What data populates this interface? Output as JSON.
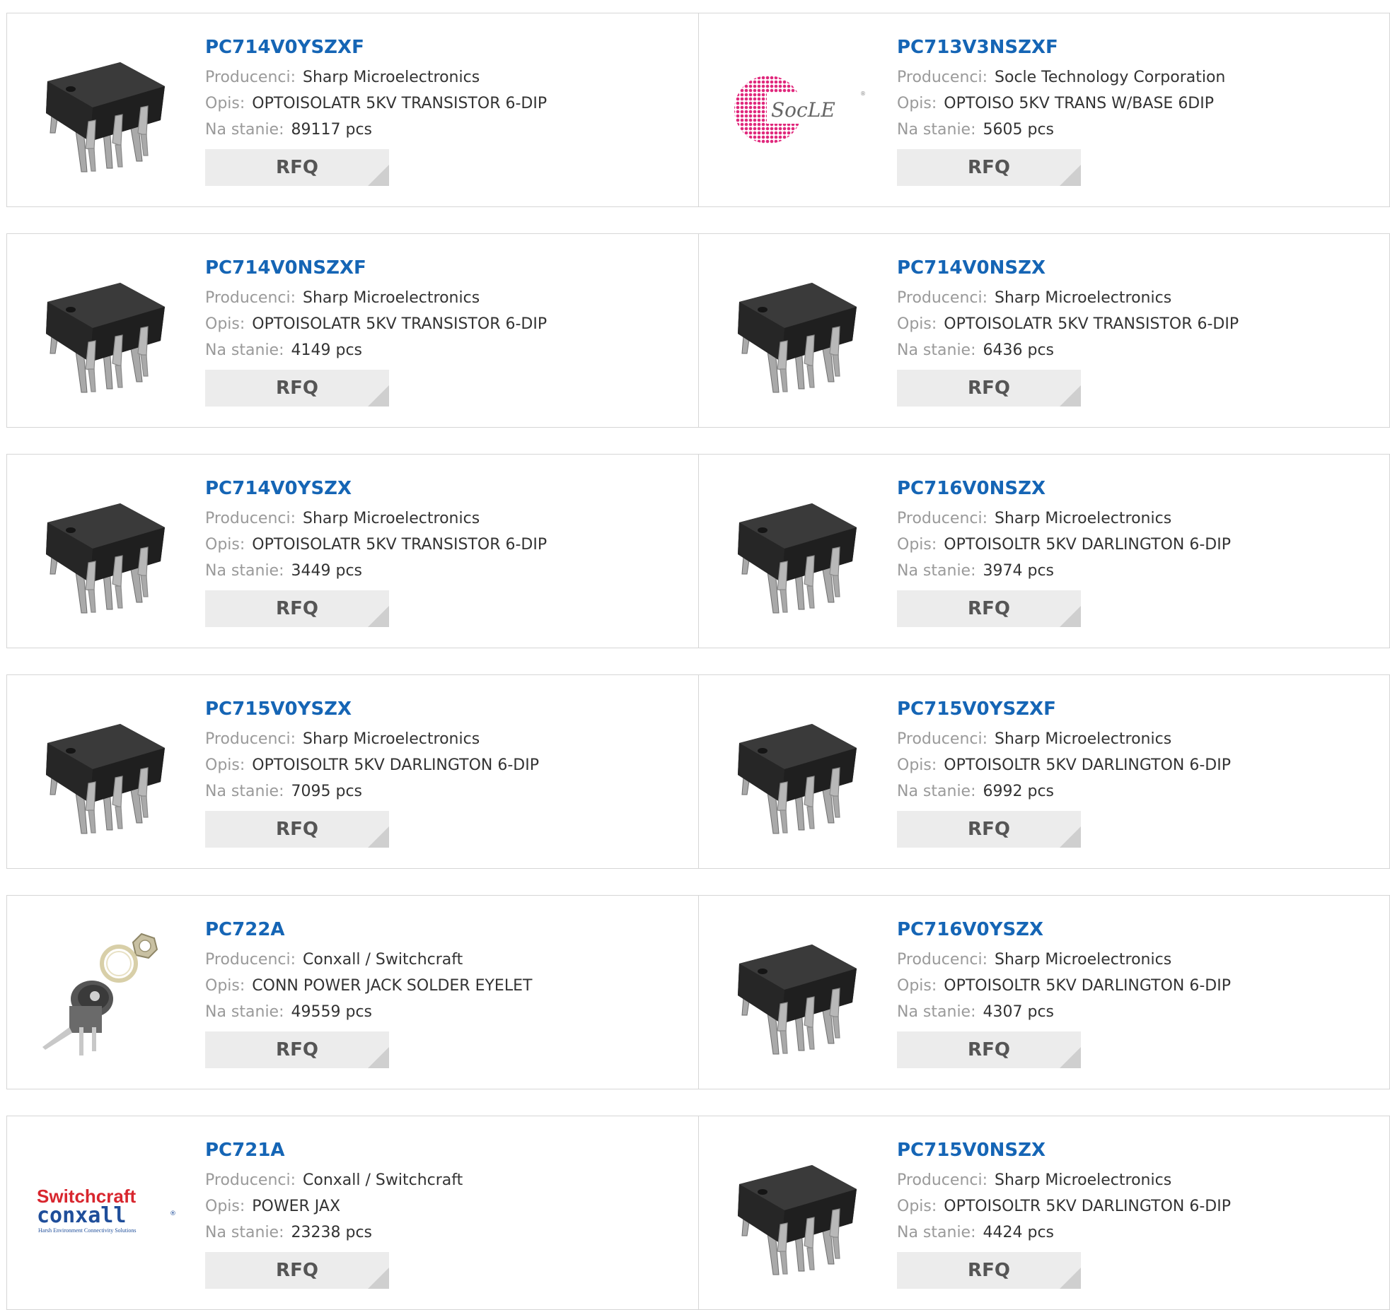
{
  "labels": {
    "manufacturer": "Producenci:",
    "description": "Opis:",
    "stock": "Na stanie:",
    "rfq": "RFQ"
  },
  "products": [
    {
      "part": "PC714V0YSZXF",
      "manufacturer": "Sharp Microelectronics",
      "description": "OPTOISOLATR 5KV TRANSISTOR 6-DIP",
      "stock": "89117 pcs",
      "image": "dip6-chip-icon"
    },
    {
      "part": "PC713V3NSZXF",
      "manufacturer": "Socle Technology Corporation",
      "description": "OPTOISO 5KV TRANS W/BASE 6DIP",
      "stock": "5605 pcs",
      "image": "socle-logo",
      "logo_text": "SocLE"
    },
    {
      "part": "PC714V0NSZXF",
      "manufacturer": "Sharp Microelectronics",
      "description": "OPTOISOLATR 5KV TRANSISTOR 6-DIP",
      "stock": "4149 pcs",
      "image": "dip6-chip-icon"
    },
    {
      "part": "PC714V0NSZX",
      "manufacturer": "Sharp Microelectronics",
      "description": "OPTOISOLATR 5KV TRANSISTOR 6-DIP",
      "stock": "6436 pcs",
      "image": "dip6-chip-icon"
    },
    {
      "part": "PC714V0YSZX",
      "manufacturer": "Sharp Microelectronics",
      "description": "OPTOISOLATR 5KV TRANSISTOR 6-DIP",
      "stock": "3449 pcs",
      "image": "dip6-chip-icon"
    },
    {
      "part": "PC716V0NSZX",
      "manufacturer": "Sharp Microelectronics",
      "description": "OPTOISOLTR 5KV DARLINGTON 6-DIP",
      "stock": "3974 pcs",
      "image": "dip6-chip-icon"
    },
    {
      "part": "PC715V0YSZX",
      "manufacturer": "Sharp Microelectronics",
      "description": "OPTOISOLTR 5KV DARLINGTON 6-DIP",
      "stock": "7095 pcs",
      "image": "dip6-chip-icon"
    },
    {
      "part": "PC715V0YSZXF",
      "manufacturer": "Sharp Microelectronics",
      "description": "OPTOISOLTR 5KV DARLINGTON 6-DIP",
      "stock": "6992 pcs",
      "image": "dip6-chip-icon"
    },
    {
      "part": "PC722A",
      "manufacturer": "Conxall / Switchcraft",
      "description": "CONN POWER JACK SOLDER EYELET",
      "stock": "49559 pcs",
      "image": "power-jack-icon"
    },
    {
      "part": "PC716V0YSZX",
      "manufacturer": "Sharp Microelectronics",
      "description": "OPTOISOLTR 5KV DARLINGTON 6-DIP",
      "stock": "4307 pcs",
      "image": "dip6-chip-icon"
    },
    {
      "part": "PC721A",
      "manufacturer": "Conxall / Switchcraft",
      "description": "POWER JAX",
      "stock": "23238 pcs",
      "image": "switchcraft-conxall-logo",
      "logo_text": [
        "Switchcraft",
        "conxall",
        "Harsh Environment Connectivity Solutions"
      ]
    },
    {
      "part": "PC715V0NSZX",
      "manufacturer": "Sharp Microelectronics",
      "description": "OPTOISOLTR 5KV DARLINGTON 6-DIP",
      "stock": "4424 pcs",
      "image": "dip6-chip-icon"
    }
  ],
  "colors": {
    "part_link": "#1565b5",
    "label": "#9a9a9a",
    "value": "#333333",
    "rfq_bg": "#ececec",
    "border": "#d6d6d6"
  }
}
